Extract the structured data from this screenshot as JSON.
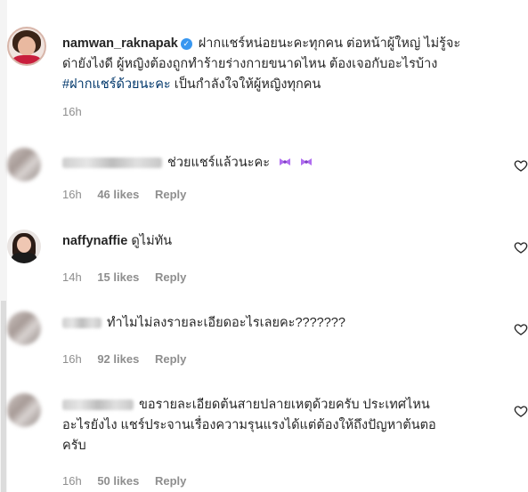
{
  "post": {
    "username": "namwan_raknapak",
    "caption_line1": "ฝากแชร์หน่อยนะคะทุกคน ต่อหน้าผู้ใหญ่ ไม่รู้จะ",
    "caption_line2": "ด่ายังไงดี ผู้หญิงต้องถูกทำร้ายร่างกายขนาดไหน ต้องเจอกับอะไรบ้าง",
    "hashtag": "#ฝากแชร์ด้วยนะคะ",
    "caption_line3_rest": "เป็นกำลังใจให้ผู้หญิงทุกคน",
    "time": "16h"
  },
  "comments": [
    {
      "username": "",
      "text_line1": "ช่วยแชร์แล้วนะคะ",
      "text_line2": "",
      "text_line3": "",
      "time": "16h",
      "likes": "46 likes",
      "reply": "Reply"
    },
    {
      "username": "naffynaffie",
      "text_line1": "ดูไม่ทัน",
      "text_line2": "",
      "text_line3": "",
      "time": "14h",
      "likes": "15 likes",
      "reply": "Reply"
    },
    {
      "username": "",
      "text_line1": "ทำไมไม่ลงรายละเอียดอะไรเลยคะ???????",
      "text_line2": "",
      "text_line3": "",
      "time": "16h",
      "likes": "92 likes",
      "reply": "Reply"
    },
    {
      "username": "",
      "text_line1": "ขอรายละเอียดต้นสายปลายเหตุด้วยครับ ประเทศไหน",
      "text_line2": "อะไรยังไง แชร์ประจานเรื่องความรุนแรงได้แต่ต้องให้ถึงปัญหาต้นตอ",
      "text_line3": "ครับ",
      "time": "16h",
      "likes": "50 likes",
      "reply": "Reply"
    }
  ],
  "icons": {
    "verified": "verified-badge-icon",
    "like": "heart-outline-icon",
    "emoji": "bow-ribbon-emoji"
  },
  "colors": {
    "hashtag": "#00376b",
    "meta": "#8e8e8e",
    "verified": "#3897f0",
    "emoji": "#b06cf0"
  }
}
